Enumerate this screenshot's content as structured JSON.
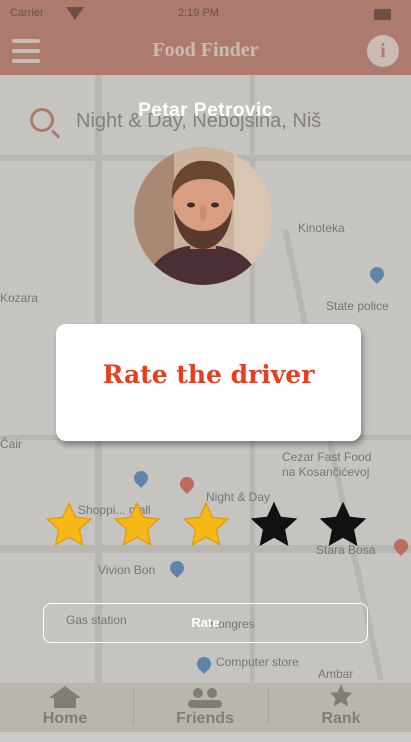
{
  "status_bar": {
    "carrier": "Carrier",
    "time": "2:19 PM"
  },
  "app_bar": {
    "title": "Food Finder",
    "info_label": "i"
  },
  "search": {
    "text": "Night & Day, Nebojsina, Niš"
  },
  "map_labels": [
    "Night & Day",
    "Cezar Fast Food",
    "na Kosančićevoj",
    "Shoppi... mall",
    "Vivion Bon",
    "Gas station",
    "Kongres",
    "Computer store",
    "Kinoteka",
    "State police",
    "Stara Bosa",
    "Kozara",
    "Čair",
    "Ambar"
  ],
  "bottom_nav": [
    {
      "label": "Home",
      "icon": "home-icon"
    },
    {
      "label": "Friends",
      "icon": "friends-icon"
    },
    {
      "label": "Rank",
      "icon": "star-icon"
    }
  ],
  "dialog": {
    "driver_name": "Petar Petrovic",
    "title": "Rate the driver",
    "rating": 3,
    "max_rating": 5,
    "button_label": "Rate"
  },
  "colors": {
    "accent": "#ea3d1e",
    "star_filled": "#f5b817",
    "star_empty": "#111111",
    "app_bar": "#c9826d"
  }
}
